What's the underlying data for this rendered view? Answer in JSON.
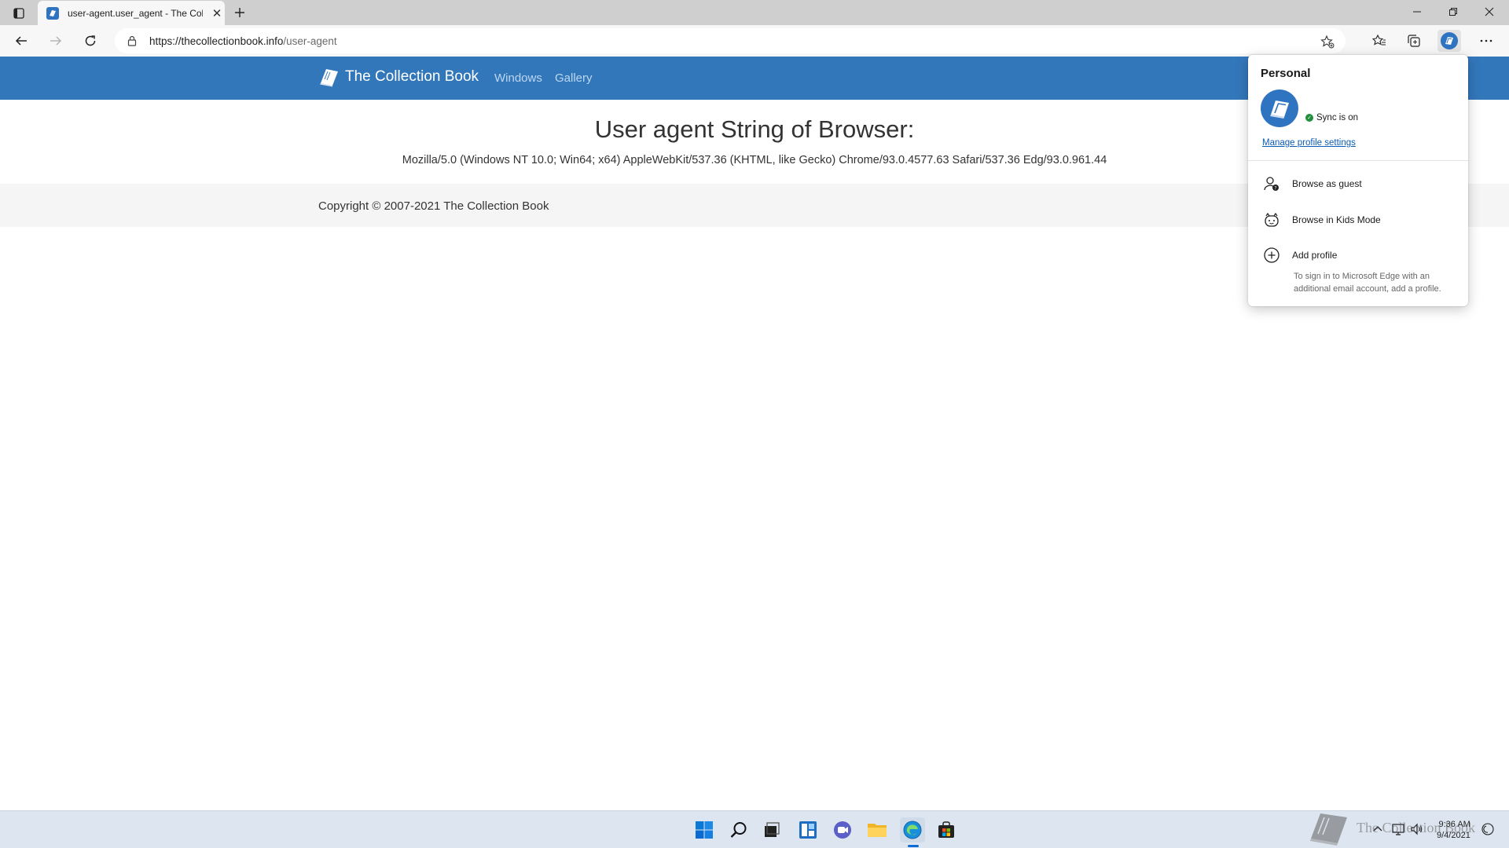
{
  "browser": {
    "tab_title": "user-agent.user_agent - The Coll",
    "url_domain": "https://thecollectionbook.info",
    "url_path": "/user-agent"
  },
  "site": {
    "brand": "The Collection Book",
    "nav": [
      "Windows",
      "Gallery"
    ],
    "headline": "User agent String of Browser:",
    "user_agent": "Mozilla/5.0 (Windows NT 10.0; Win64; x64) AppleWebKit/537.36 (KHTML, like Gecko) Chrome/93.0.4577.63 Safari/537.36 Edg/93.0.961.44",
    "copyright": "Copyright © 2007-2021 The Collection Book"
  },
  "profile_flyout": {
    "title": "Personal",
    "sync_status": "Sync is on",
    "manage_link": "Manage profile settings",
    "items": [
      {
        "label": "Browse as guest",
        "icon": "guest-icon"
      },
      {
        "label": "Browse in Kids Mode",
        "icon": "kids-mode-icon"
      },
      {
        "label": "Add profile",
        "icon": "add-circle-icon"
      }
    ],
    "add_profile_desc": "To sign in to Microsoft Edge with an additional email account, add a profile."
  },
  "taskbar": {
    "time": "9:36 AM",
    "date": "9/4/2021",
    "watermark": "The Collection Book"
  },
  "colors": {
    "navbar": "#3377bb",
    "link": "#0b5cb5",
    "sync_ok": "#1f8f3a"
  }
}
